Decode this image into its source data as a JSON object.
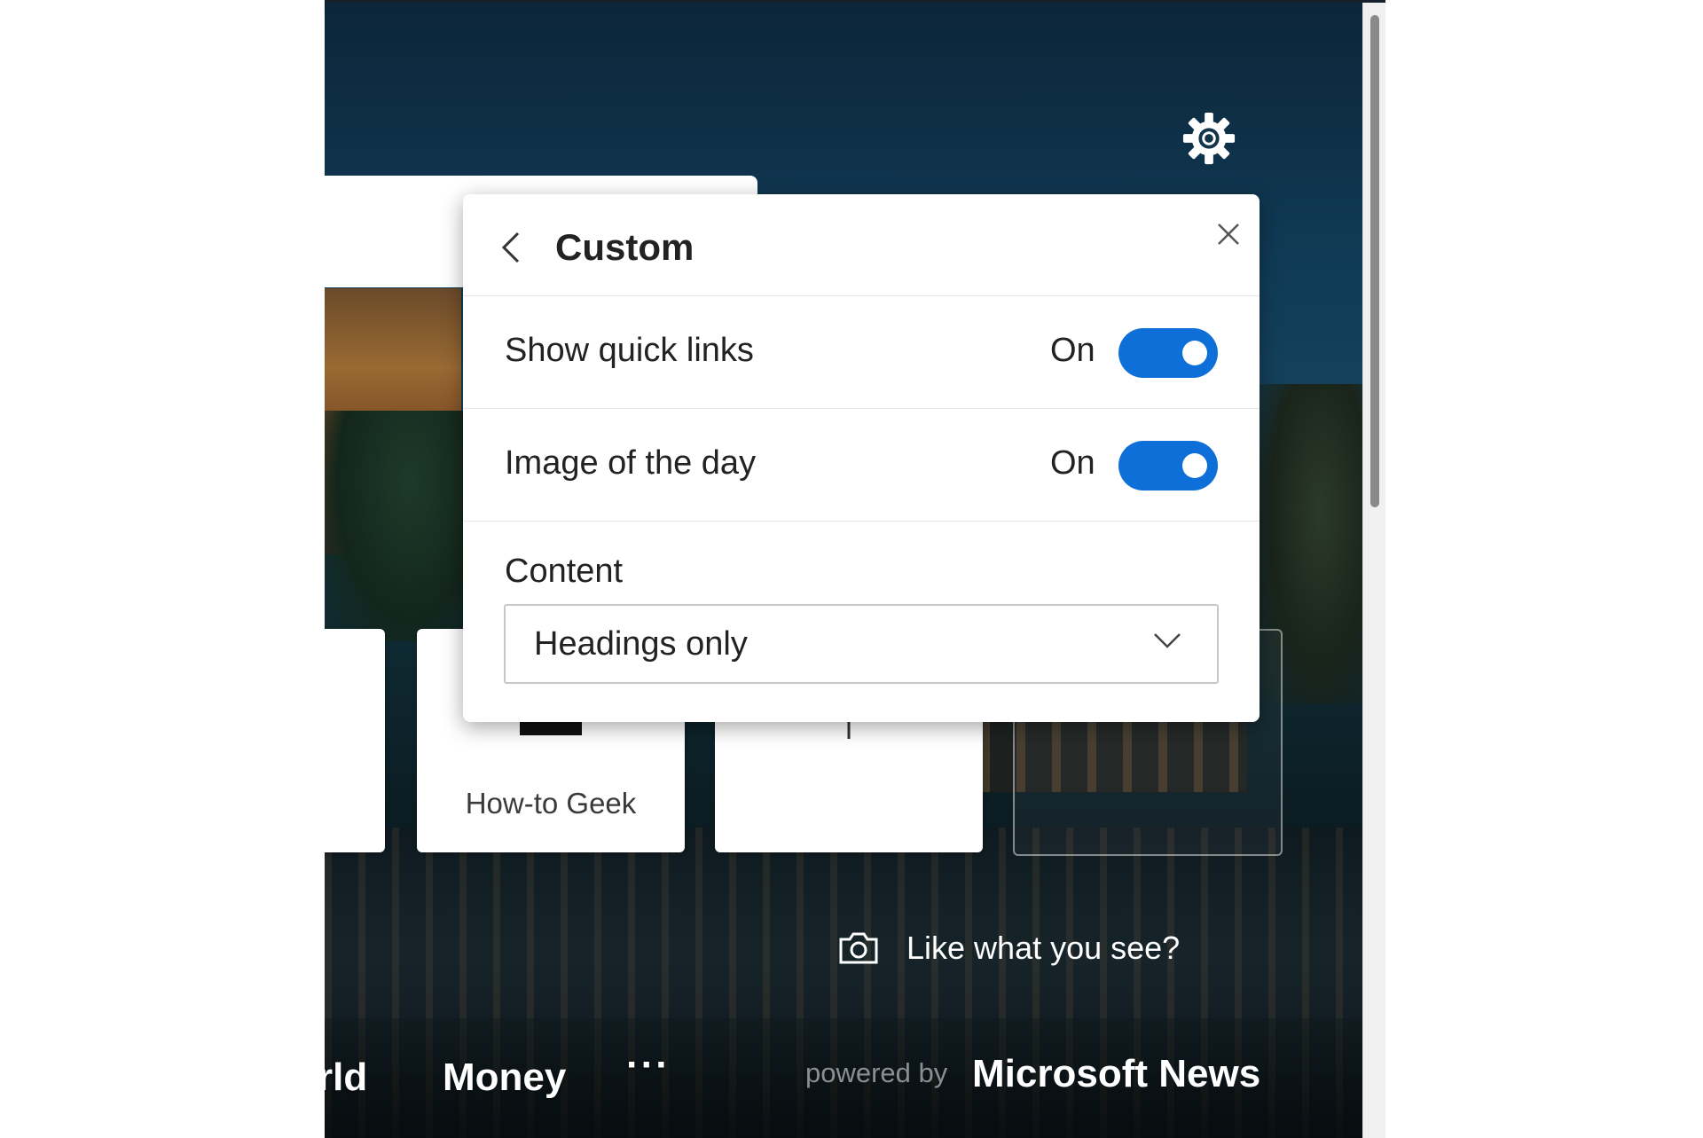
{
  "panel": {
    "title": "Custom",
    "rows": [
      {
        "label": "Show quick links",
        "state": "On",
        "enabled": true
      },
      {
        "label": "Image of the day",
        "state": "On",
        "enabled": true
      }
    ],
    "content": {
      "label": "Content",
      "selected": "Headings only"
    }
  },
  "quick_links": [
    {
      "label": "How-to Geek"
    }
  ],
  "like_prompt": "Like what you see?",
  "bottom_nav": {
    "items": [
      "rld",
      "Money"
    ],
    "more": "···",
    "powered_by": "powered by",
    "brand": "Microsoft News"
  },
  "colors": {
    "toggle_on": "#0f6fd8",
    "panel_bg": "#ffffff"
  }
}
